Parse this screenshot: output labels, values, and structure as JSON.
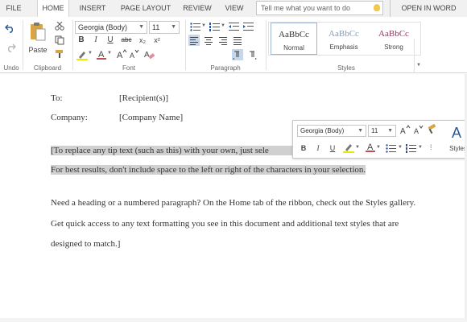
{
  "tabs": {
    "file": "FILE",
    "home": "HOME",
    "insert": "INSERT",
    "page_layout": "PAGE LAYOUT",
    "review": "REVIEW",
    "view": "VIEW",
    "tell_me_placeholder": "Tell me what you want to do",
    "open_in_word": "OPEN IN WORD"
  },
  "ribbon": {
    "undo_label": "Undo",
    "clipboard": {
      "paste_label": "Paste",
      "group_label": "Clipboard"
    },
    "font": {
      "font_name": "Georgia (Body)",
      "font_size": "11",
      "group_label": "Font",
      "bold": "B",
      "italic": "I",
      "underline": "U",
      "strike": "abc",
      "subscript": "x₂",
      "superscript": "x²",
      "highlight_color": "#f2e600",
      "font_color": "#c0504d"
    },
    "paragraph": {
      "group_label": "Paragraph"
    },
    "styles": {
      "group_label": "Styles",
      "items": [
        {
          "sample": "AaBbCc",
          "name": "Normal",
          "color": "#333333"
        },
        {
          "sample": "AaBbCc",
          "name": "Emphasis",
          "color": "#8a9bb5"
        },
        {
          "sample": "AaBbCc",
          "name": "Strong",
          "color": "#8b3a62"
        }
      ]
    }
  },
  "document": {
    "to_label": "To:",
    "to_value": "[Recipient(s)]",
    "company_label": "Company:",
    "company_value": "[Company Name]",
    "tip_line1": "[To replace any tip text (such as this) with your own, just sele",
    "tip_line2": "For best results, don't include space to the left or right of the characters in your selection.",
    "para_line1": "Need a heading or a numbered paragraph? On the Home tab of the ribbon, check out the Styles gallery.",
    "para_line2": "Get quick access to any text formatting you see in this document and additional text styles that are",
    "para_line3": "designed to match.]"
  },
  "mini_toolbar": {
    "font_name": "Georgia (Body)",
    "font_size": "11",
    "styles_label": "Styles"
  }
}
